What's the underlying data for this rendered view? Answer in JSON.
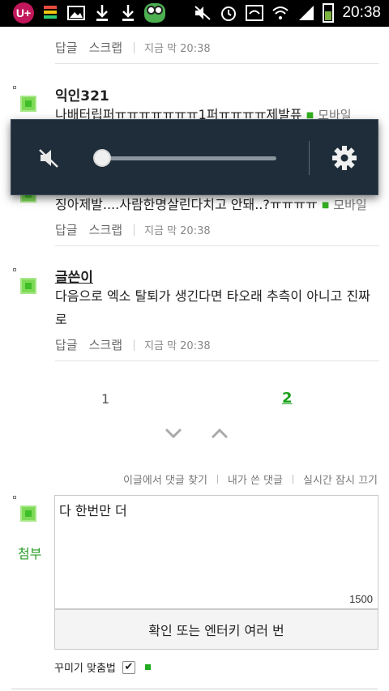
{
  "status_bar": {
    "left_icons": [
      "uplus-icon",
      "storage-icon",
      "image-icon",
      "download-icon",
      "download-icon",
      "frog-app-icon"
    ],
    "right_icons": [
      "mute-icon",
      "alarm-icon",
      "wifi-data-icon",
      "wifi-icon",
      "signal-icon",
      "battery-icon"
    ],
    "uplus_label": "U+",
    "time": "20:38"
  },
  "comments": [
    {
      "id": "c0",
      "author": "",
      "text": "",
      "actions": {
        "reply": "답글",
        "scrap": "스크랩",
        "time": "지금 막 20:38"
      }
    },
    {
      "id": "c1",
      "author": "익인321",
      "text_line1": "나배터립퍼ㅠㅠㅠㅠㅠㅠㅠ1퍼ㅠㅠㅠㅠ제발퓨",
      "mobile_tag": "모바일"
    },
    {
      "id": "c2",
      "text": "징아제발....사람한명살린다치고 안돼..?ㅠㅠㅠㅠ",
      "mobile_tag": "모바일",
      "actions": {
        "reply": "답글",
        "scrap": "스크랩",
        "time": "지금 막 20:38"
      }
    },
    {
      "id": "c3",
      "author": "글쓴이",
      "text": "다음으로 엑소 탈퇴가 생긴다면 타오래 추측이 아니고 진짜로",
      "actions": {
        "reply": "답글",
        "scrap": "스크랩",
        "time": "지금 막 20:38"
      }
    }
  ],
  "volume": {
    "level": 0.03
  },
  "pagination": {
    "pages": [
      "1",
      "2"
    ],
    "current": "2"
  },
  "links": {
    "find_in_post": "이글에서 댓글 찾기",
    "my_comments": "내가 쓴 댓글",
    "realtime_off": "실시간 잠시 끄기"
  },
  "compose": {
    "attach_label": "첨부",
    "value": "다 한번만 더",
    "char_count": "1500",
    "submit_label": "확인 또는 엔터키 여러 번",
    "decorate_label": "꾸미기 맞춤법",
    "decorate_checked": true
  },
  "colors": {
    "accent_green": "#1aa01a",
    "overlay_bg": "#1f2d3a"
  }
}
